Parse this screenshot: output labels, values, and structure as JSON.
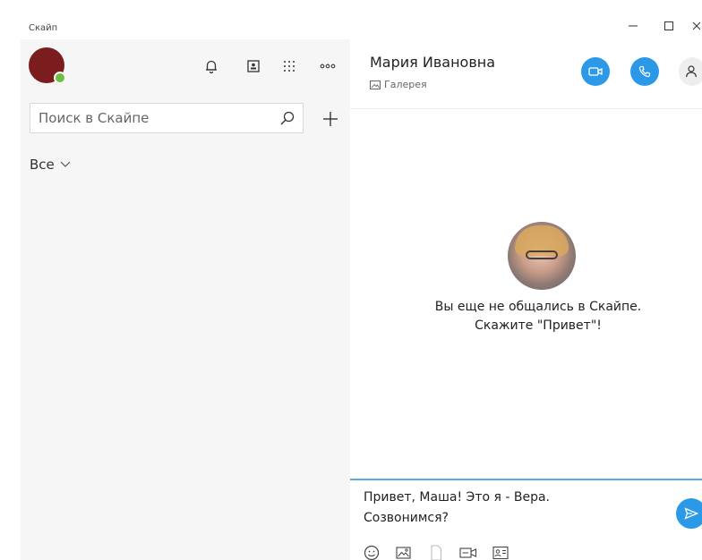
{
  "window": {
    "title": "Скайп",
    "minimize_icon": "minimize-icon",
    "maximize_icon": "maximize-icon"
  },
  "sidebar": {
    "search": {
      "placeholder": "Поиск в Скайпе",
      "value": ""
    },
    "filter_label": "Все",
    "icons": [
      "bell-icon",
      "contacts-icon",
      "dialpad-icon",
      "more-icon"
    ],
    "presence_color": "#6cbe45",
    "avatar_color": "#7b1d1f"
  },
  "chat": {
    "contact_name": "Мария Ивановна",
    "gallery_label": "Галерея",
    "empty_line1": "Вы еще не общались в Скайпе.",
    "empty_line2": "Скажите \"Привет\"!",
    "accent_color": "#2b99e8"
  },
  "composer": {
    "text": "Привет, Маша! Это я - Вера.\nСозвонимся?",
    "tools": [
      "emoji-icon",
      "image-icon",
      "file-icon",
      "video-message-icon",
      "contact-card-icon"
    ]
  }
}
